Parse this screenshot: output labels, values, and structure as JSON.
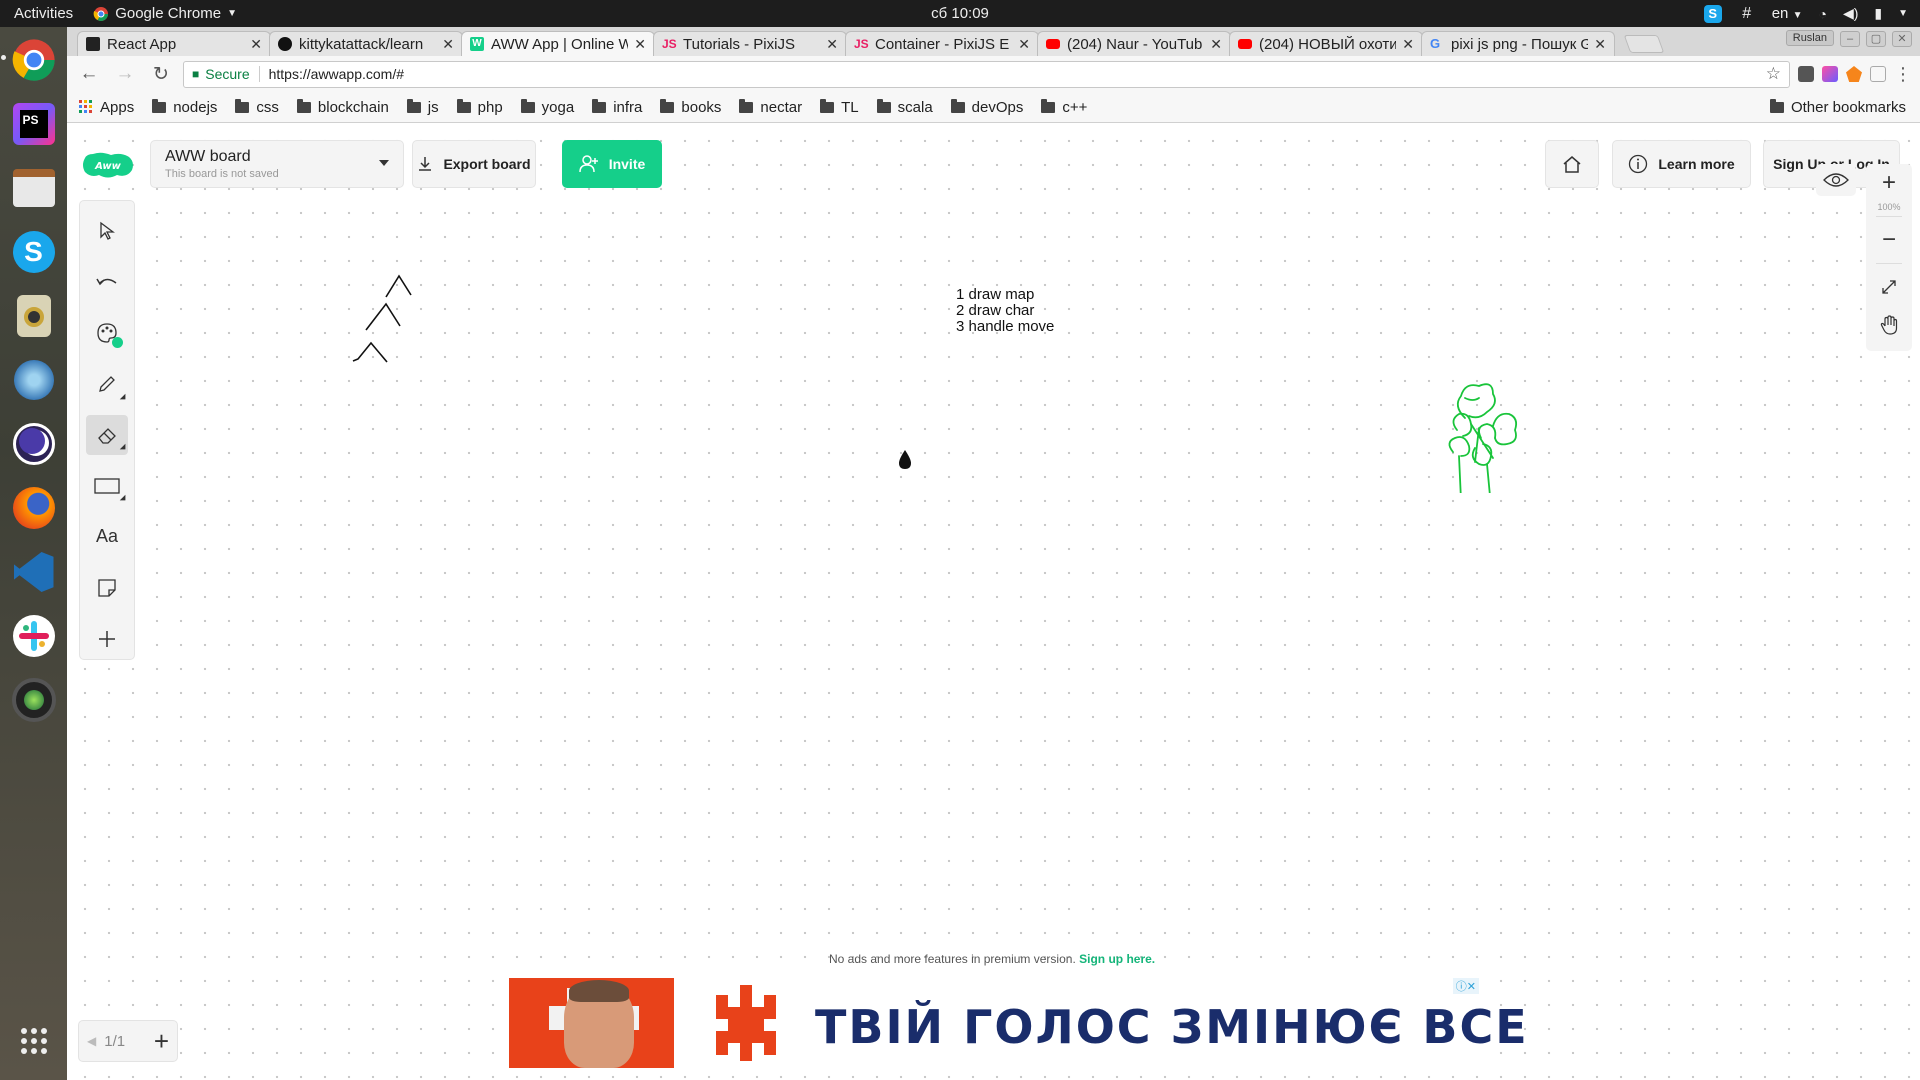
{
  "os": {
    "activities": "Activities",
    "app_menu": "Google Chrome",
    "clock": "сб 10:09",
    "lang": "en"
  },
  "dock": [
    "chrome",
    "phpstorm",
    "files",
    "skype",
    "rhythmbox",
    "app",
    "eclipse",
    "firefox",
    "vscode",
    "slack",
    "webcam"
  ],
  "tabs": [
    {
      "title": "React App",
      "icon": "react-icon",
      "active": false
    },
    {
      "title": "kittykatattack/learn",
      "icon": "github-icon",
      "active": false
    },
    {
      "title": "AWW App | Online W",
      "icon": "aww-icon",
      "active": true
    },
    {
      "title": "Tutorials - PixiJS",
      "icon": "pixijs-icon",
      "active": false
    },
    {
      "title": "Container - PixiJS E",
      "icon": "pixijs-icon",
      "active": false
    },
    {
      "title": "(204) Naur - YouTub",
      "icon": "youtube-icon",
      "active": false
    },
    {
      "title": "(204) НОВЫЙ охоти",
      "icon": "youtube-icon",
      "active": false
    },
    {
      "title": "pixi js png - Пошук G",
      "icon": "google-icon",
      "active": false
    }
  ],
  "profile": "Ruslan",
  "omnibox": {
    "secure": "Secure",
    "url": "https://awwapp.com/#"
  },
  "bookmarks": {
    "apps": "Apps",
    "folders": [
      "nodejs",
      "css",
      "blockchain",
      "js",
      "php",
      "yoga",
      "infra",
      "books",
      "nectar",
      "TL",
      "scala",
      "devOps",
      "c++"
    ],
    "other": "Other bookmarks"
  },
  "aww": {
    "board_name": "AWW board",
    "board_status": "This board is not saved",
    "export": "Export board",
    "invite": "Invite",
    "learn_more": "Learn more",
    "signup": "Sign Up or Log In",
    "zoom": "100%",
    "tools": [
      "select",
      "undo",
      "color",
      "pencil",
      "eraser",
      "shape",
      "text",
      "sticky",
      "add"
    ],
    "selected_tool": "eraser",
    "colors": {
      "accent": "#15cf8a",
      "drawing_green": "#19c43a"
    }
  },
  "canvas": {
    "notes": [
      "1 draw map",
      "2 draw char",
      "3 handle move"
    ]
  },
  "footer": {
    "premium_text": "No ads and more features in premium version.",
    "premium_link": "Sign up here.",
    "ad_slogan": "ТВІЙ ГОЛОС ЗМІНЮЄ ВСЕ",
    "pager": "1/1"
  }
}
